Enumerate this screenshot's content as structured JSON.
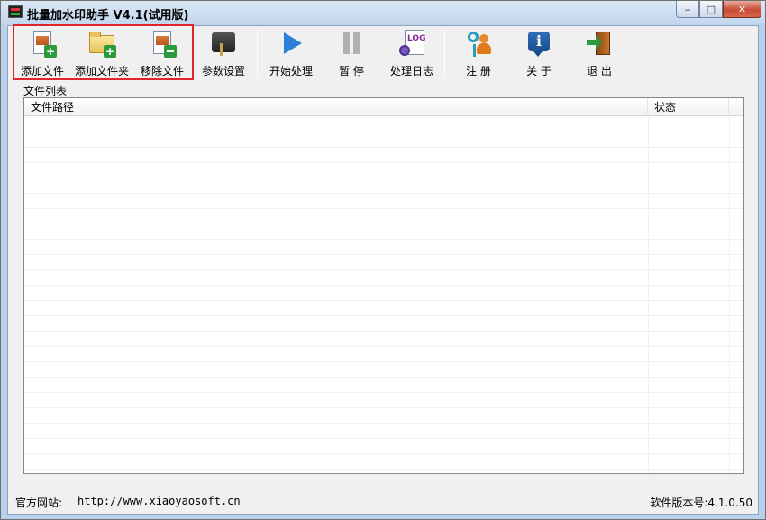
{
  "window": {
    "title": "批量加水印助手 V4.1(试用版)",
    "controls": {
      "minimize": "‒",
      "maximize": "□",
      "close": "✕"
    }
  },
  "toolbar": {
    "buttons": [
      {
        "label": "添加文件",
        "icon": "add-file-icon"
      },
      {
        "label": "添加文件夹",
        "icon": "add-folder-icon"
      },
      {
        "label": "移除文件",
        "icon": "remove-file-icon"
      },
      {
        "label": "参数设置",
        "icon": "settings-icon"
      },
      {
        "label": "开始处理",
        "icon": "play-icon"
      },
      {
        "label": "暂 停",
        "icon": "pause-icon"
      },
      {
        "label": "处理日志",
        "icon": "log-icon"
      },
      {
        "label": "注 册",
        "icon": "register-key-icon"
      },
      {
        "label": "关 于",
        "icon": "info-icon"
      },
      {
        "label": "退 出",
        "icon": "exit-door-icon"
      }
    ]
  },
  "file_list": {
    "group_label": "文件列表",
    "columns": [
      "文件路径",
      "状态"
    ],
    "rows": []
  },
  "statusbar": {
    "site_label": "官方网站:",
    "site_url": "http://www.xiaoyaosoft.cn",
    "version": "软件版本号:4.1.0.50"
  },
  "colors": {
    "highlight_border": "#e0262b",
    "play_blue": "#2e7fd8",
    "close_red": "#c74b33"
  }
}
